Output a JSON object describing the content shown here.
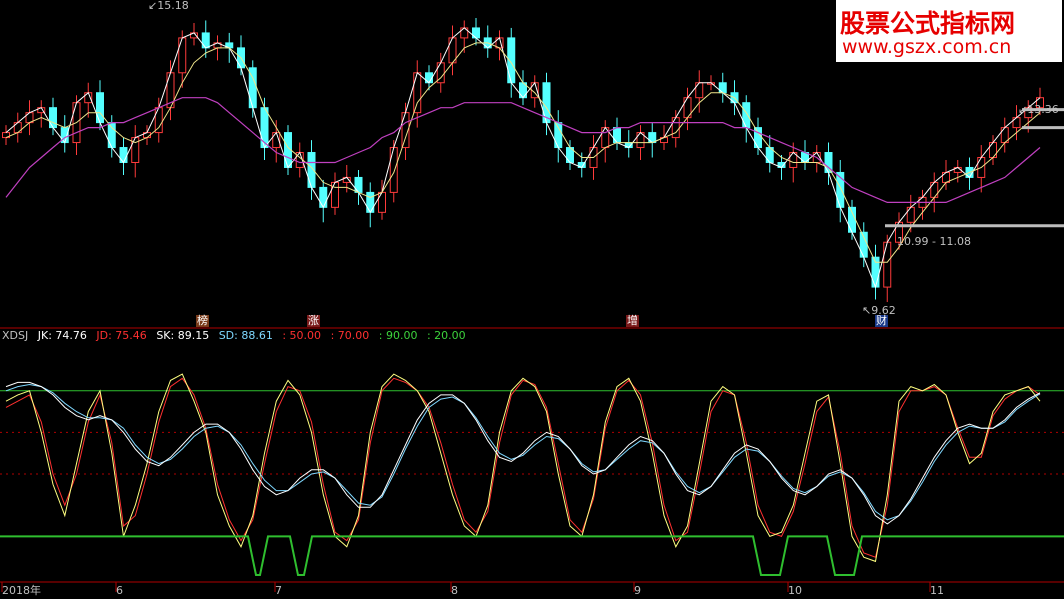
{
  "watermark": {
    "title": "股票公式指标网",
    "url": "www.gszx.com.cn"
  },
  "annotations": {
    "high": "15.18",
    "low": "9.62",
    "level1": "13.36 -",
    "range": "10.99 - 11.08"
  },
  "markers": [
    {
      "text": "榜",
      "bg": "#7a3b1a"
    },
    {
      "text": "涨",
      "bg": "#7a1a1a"
    },
    {
      "text": "增",
      "bg": "#7a1a1a"
    },
    {
      "text": "财",
      "bg": "#1a3a8a"
    }
  ],
  "legend": [
    {
      "text": "XDSJ",
      "color": "#c0c0c0"
    },
    {
      "text": "JK: 74.76",
      "color": "#ffffff"
    },
    {
      "text": "JD: 75.46",
      "color": "#ff3030"
    },
    {
      "text": "SK: 89.15",
      "color": "#ffffff"
    },
    {
      "text": "SD: 88.61",
      "color": "#7fd8ff"
    },
    {
      "text": ": 50.00",
      "color": "#ff3030"
    },
    {
      "text": ": 70.00",
      "color": "#ff3030"
    },
    {
      "text": ": 90.00",
      "color": "#3cd23c"
    },
    {
      "text": ": 20.00",
      "color": "#3cd23c"
    }
  ],
  "x_labels": [
    "2018年",
    "6",
    "7",
    "8",
    "9",
    "10",
    "11"
  ],
  "chart_data": {
    "type": "candlestick",
    "price": {
      "close": [
        12.9,
        13.1,
        13.3,
        13.4,
        13.0,
        12.7,
        13.5,
        13.7,
        13.1,
        12.6,
        12.3,
        12.8,
        12.9,
        13.4,
        14.1,
        14.8,
        14.9,
        14.6,
        14.7,
        14.6,
        14.2,
        13.4,
        12.6,
        12.9,
        12.2,
        12.5,
        11.8,
        11.4,
        11.9,
        12.0,
        11.7,
        11.3,
        11.7,
        12.6,
        13.3,
        14.1,
        13.9,
        14.3,
        14.8,
        15.0,
        14.8,
        14.6,
        14.8,
        13.9,
        13.6,
        13.9,
        13.1,
        12.6,
        12.3,
        12.2,
        12.6,
        13.0,
        12.7,
        12.6,
        12.9,
        12.7,
        12.8,
        13.2,
        13.6,
        13.9,
        13.9,
        13.7,
        13.5,
        13.0,
        12.6,
        12.3,
        12.2,
        12.5,
        12.3,
        12.5,
        12.1,
        11.4,
        10.9,
        10.4,
        9.8,
        10.7,
        11.1,
        11.4,
        11.6,
        11.9,
        12.1,
        12.2,
        12.0,
        12.4,
        12.7,
        13.0,
        13.2,
        13.4,
        13.6
      ],
      "ma_short": [
        12.8,
        12.9,
        13.1,
        13.2,
        13.1,
        13.0,
        13.1,
        13.3,
        13.3,
        13.0,
        12.8,
        12.7,
        12.8,
        13.0,
        13.4,
        13.9,
        14.3,
        14.5,
        14.6,
        14.6,
        14.4,
        14.0,
        13.4,
        13.0,
        12.6,
        12.4,
        12.2,
        11.9,
        11.8,
        11.8,
        11.7,
        11.6,
        11.7,
        12.1,
        12.8,
        13.5,
        13.8,
        14.0,
        14.3,
        14.6,
        14.7,
        14.7,
        14.6,
        14.3,
        13.9,
        13.7,
        13.4,
        13.0,
        12.6,
        12.4,
        12.4,
        12.6,
        12.7,
        12.7,
        12.7,
        12.7,
        12.8,
        12.9,
        13.2,
        13.5,
        13.7,
        13.7,
        13.6,
        13.3,
        12.9,
        12.6,
        12.4,
        12.3,
        12.3,
        12.3,
        12.2,
        11.8,
        11.3,
        10.8,
        10.3,
        10.3,
        10.6,
        11.0,
        11.3,
        11.6,
        11.9,
        12.0,
        12.1,
        12.2,
        12.4,
        12.7,
        12.9,
        13.1,
        13.3
      ],
      "ma_long": [
        11.6,
        11.9,
        12.2,
        12.4,
        12.6,
        12.8,
        12.9,
        13.0,
        13.0,
        13.1,
        13.1,
        13.2,
        13.3,
        13.4,
        13.5,
        13.6,
        13.6,
        13.6,
        13.5,
        13.3,
        13.1,
        12.9,
        12.7,
        12.5,
        12.4,
        12.3,
        12.3,
        12.3,
        12.3,
        12.4,
        12.5,
        12.6,
        12.8,
        12.9,
        13.1,
        13.2,
        13.3,
        13.4,
        13.4,
        13.5,
        13.5,
        13.5,
        13.5,
        13.5,
        13.4,
        13.3,
        13.2,
        13.1,
        13.0,
        12.9,
        12.9,
        12.9,
        13.0,
        13.0,
        13.1,
        13.1,
        13.1,
        13.1,
        13.1,
        13.1,
        13.1,
        13.1,
        13.0,
        13.0,
        12.9,
        12.8,
        12.7,
        12.6,
        12.5,
        12.4,
        12.2,
        12.0,
        11.8,
        11.7,
        11.6,
        11.5,
        11.5,
        11.5,
        11.5,
        11.5,
        11.5,
        11.6,
        11.7,
        11.8,
        11.9,
        12.0,
        12.2,
        12.4,
        12.6
      ],
      "ylim": [
        9.3,
        15.4
      ]
    },
    "indicator": {
      "JK": [
        85,
        88,
        90,
        70,
        45,
        30,
        55,
        80,
        90,
        60,
        20,
        35,
        55,
        80,
        95,
        98,
        85,
        70,
        40,
        25,
        15,
        30,
        60,
        85,
        95,
        88,
        70,
        40,
        20,
        15,
        30,
        70,
        92,
        98,
        95,
        90,
        80,
        60,
        40,
        25,
        20,
        35,
        70,
        90,
        96,
        92,
        80,
        50,
        25,
        20,
        40,
        75,
        92,
        96,
        85,
        60,
        30,
        15,
        25,
        55,
        85,
        92,
        88,
        60,
        30,
        20,
        22,
        35,
        60,
        85,
        88,
        55,
        20,
        10,
        8,
        40,
        85,
        92,
        90,
        93,
        88,
        70,
        55,
        60,
        80,
        88,
        90,
        92,
        85
      ],
      "JD": [
        82,
        85,
        88,
        75,
        50,
        35,
        50,
        75,
        88,
        65,
        25,
        30,
        50,
        75,
        92,
        96,
        88,
        72,
        45,
        28,
        18,
        28,
        55,
        80,
        92,
        90,
        75,
        45,
        22,
        18,
        28,
        65,
        90,
        96,
        94,
        90,
        82,
        65,
        45,
        28,
        22,
        32,
        65,
        88,
        95,
        93,
        82,
        55,
        28,
        22,
        38,
        72,
        90,
        95,
        88,
        65,
        35,
        18,
        22,
        50,
        80,
        90,
        88,
        65,
        35,
        22,
        20,
        32,
        55,
        80,
        87,
        60,
        25,
        12,
        10,
        35,
        80,
        90,
        90,
        92,
        88,
        72,
        58,
        58,
        78,
        86,
        90,
        92,
        88
      ],
      "SK": [
        92,
        94,
        94,
        92,
        88,
        82,
        78,
        76,
        78,
        76,
        70,
        62,
        56,
        54,
        58,
        64,
        70,
        74,
        74,
        70,
        62,
        52,
        44,
        40,
        42,
        48,
        52,
        52,
        48,
        40,
        34,
        34,
        40,
        52,
        64,
        76,
        84,
        88,
        88,
        84,
        76,
        66,
        58,
        56,
        60,
        66,
        70,
        68,
        62,
        54,
        50,
        52,
        58,
        64,
        68,
        66,
        60,
        50,
        42,
        40,
        44,
        52,
        60,
        64,
        62,
        56,
        48,
        42,
        40,
        44,
        50,
        52,
        48,
        40,
        30,
        26,
        30,
        38,
        48,
        58,
        66,
        72,
        74,
        72,
        72,
        76,
        82,
        86,
        89
      ],
      "SD": [
        90,
        92,
        93,
        92,
        89,
        84,
        80,
        77,
        77,
        76,
        72,
        64,
        58,
        55,
        57,
        62,
        68,
        72,
        73,
        70,
        64,
        55,
        47,
        42,
        42,
        46,
        50,
        51,
        48,
        42,
        36,
        35,
        39,
        50,
        62,
        73,
        82,
        86,
        87,
        84,
        77,
        68,
        60,
        57,
        59,
        64,
        68,
        67,
        62,
        55,
        51,
        52,
        57,
        62,
        66,
        65,
        60,
        51,
        44,
        41,
        44,
        51,
        58,
        62,
        61,
        56,
        49,
        43,
        41,
        44,
        49,
        51,
        48,
        41,
        32,
        28,
        30,
        37,
        46,
        56,
        64,
        70,
        73,
        72,
        72,
        75,
        81,
        85,
        88.6
      ],
      "levels": [
        50,
        70,
        90,
        20
      ],
      "ylim": [
        0,
        112
      ]
    }
  }
}
